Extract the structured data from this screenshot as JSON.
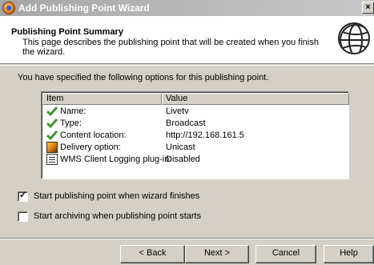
{
  "window": {
    "title": "Add Publishing Point Wizard",
    "close_glyph": "×"
  },
  "header": {
    "title": "Publishing Point Summary",
    "description": "This page describes the publishing point that will be created when you finish the wizard."
  },
  "intro": "You have specified the following options for this publishing point.",
  "list": {
    "columns": [
      "Item",
      "Value"
    ],
    "rows": [
      {
        "icon": "green-check-icon",
        "label": "Name:",
        "value": "Livetv"
      },
      {
        "icon": "green-check-icon",
        "label": "Type:",
        "value": "Broadcast"
      },
      {
        "icon": "green-check-icon",
        "label": "Content location:",
        "value": "http://192.168.161.5"
      },
      {
        "icon": "delivery-icon",
        "label": "Delivery option:",
        "value": "Unicast"
      },
      {
        "icon": "logging-icon",
        "label": "WMS Client Logging plug-in:",
        "value": "Disabled"
      }
    ]
  },
  "options": [
    {
      "label": "Start publishing point when wizard finishes",
      "checked": true
    },
    {
      "label": "Start archiving when publishing point starts",
      "checked": false
    }
  ],
  "buttons": {
    "back": "< Back",
    "next": "Next >",
    "cancel": "Cancel",
    "help": "Help"
  },
  "colors": {
    "title_bar": "#a6a6a6",
    "dialog_bg": "#d4d0c8",
    "check_green": "#3a9a2a"
  }
}
